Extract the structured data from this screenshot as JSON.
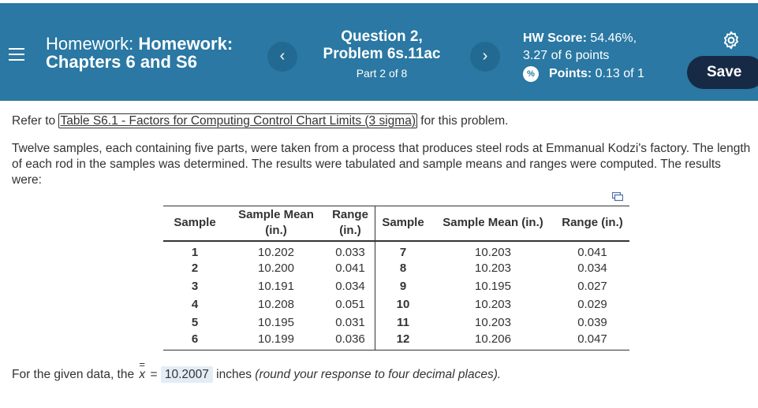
{
  "header": {
    "title_prefix": "Homework: ",
    "title_bold": "Homework: Chapters 6 and S6",
    "question_title": "Question 2, Problem 6s.11ac",
    "part_label": "Part 2 of 8",
    "hw_score_label": "HW Score:",
    "hw_score_value": "54.46%,",
    "points_summary": "3.27 of 6 points",
    "points_label": "Points:",
    "points_value": "0.13 of 1",
    "save_label": "Save",
    "prev_icon": "‹",
    "next_icon": "›",
    "points_icon": "%"
  },
  "content": {
    "refer_prefix": "Refer to ",
    "refer_link": "Table S6.1 - Factors for Computing Control Chart Limits (3 sigma)",
    "refer_suffix": " for this problem.",
    "problem_text": "Twelve samples, each containing five parts, were taken from a process that produces steel rods at Emmanual Kodzi's factory. The length of each rod in the samples was determined. The results were tabulated and sample means and ranges were computed. The results were:"
  },
  "table": {
    "headers": [
      "Sample",
      "Sample Mean (in.)",
      "Range (in.)",
      "Sample",
      "Sample Mean (in.)",
      "Range (in.)"
    ],
    "rows": [
      [
        "1",
        "10.202",
        "0.033",
        "7",
        "10.203",
        "0.041"
      ],
      [
        "2",
        "10.200",
        "0.041",
        "8",
        "10.203",
        "0.034"
      ],
      [
        "3",
        "10.191",
        "0.034",
        "9",
        "10.195",
        "0.027"
      ],
      [
        "4",
        "10.208",
        "0.051",
        "10",
        "10.203",
        "0.029"
      ],
      [
        "5",
        "10.195",
        "0.031",
        "11",
        "10.203",
        "0.039"
      ],
      [
        "6",
        "10.199",
        "0.036",
        "12",
        "10.206",
        "0.047"
      ]
    ]
  },
  "answer": {
    "prefix": "For the given data, the ",
    "symbol": "x",
    "equals": " = ",
    "value": "10.2007",
    "units": " inches ",
    "hint": "(round your response to four decimal places)."
  },
  "colors": {
    "header_bg": "#2a78a3",
    "save_bg": "#172a45",
    "answer_bg": "#e4ecf6"
  }
}
